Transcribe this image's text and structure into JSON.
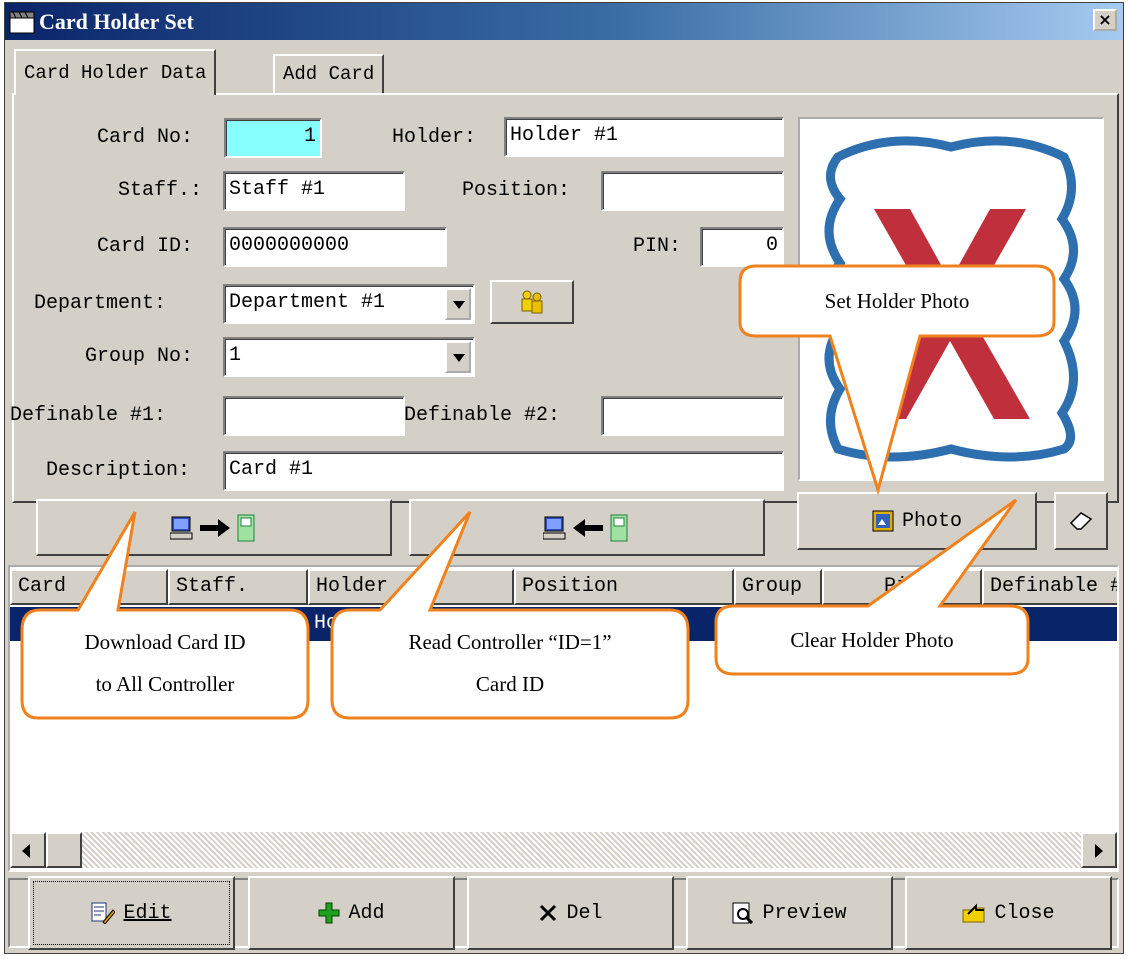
{
  "window": {
    "title": "Card Holder Set",
    "close_glyph": "×"
  },
  "tabs": [
    {
      "label": "Card Holder Data",
      "active": true
    },
    {
      "label": "Add Card",
      "active": false
    }
  ],
  "form": {
    "card_no_label": "Card No:",
    "card_no_value": "1",
    "holder_label": "Holder:",
    "holder_value": "Holder #1",
    "staff_label": "Staff.:",
    "staff_value": "Staff #1",
    "position_label": "Position:",
    "position_value": "",
    "card_id_label": "Card ID:",
    "card_id_value": "0000000000",
    "pin_label": "PIN:",
    "pin_value": "0",
    "department_label": "Department:",
    "department_value": "Department #1",
    "group_label": "Group No:",
    "group_value": "1",
    "def1_label": "Definable #1:",
    "def1_value": "",
    "def2_label": "Definable #2:",
    "def2_value": "",
    "description_label": "Description:",
    "description_value": "Card #1"
  },
  "buttons": {
    "photo_label": "Photo"
  },
  "grid": {
    "columns": [
      "Card",
      "Staff.",
      "Holder",
      "",
      "Position",
      "Group",
      "Pin",
      "Definable #"
    ],
    "rows": [
      {
        "holder": "Ho"
      }
    ]
  },
  "toolbar": {
    "edit": "Edit",
    "add": "Add",
    "del": "Del",
    "preview": "Preview",
    "close": "Close"
  },
  "callouts": {
    "download": "Download Card ID\nto All Controller",
    "read": "Read Controller “ID=1”\nCard ID",
    "set_photo": "Set Holder Photo",
    "clear_photo": "Clear Holder Photo"
  },
  "colors": {
    "selection": "#0a246a",
    "card_no_bg": "#88ffff",
    "callout_border": "#f0821e",
    "photo_x": "#c0303c",
    "photo_frame": "#2e6fb0"
  },
  "icons": [
    "department-lookup-icon",
    "download-to-controller-icon",
    "read-from-controller-icon",
    "photo-icon",
    "eraser-icon",
    "edit-icon",
    "add-icon",
    "delete-icon",
    "preview-icon",
    "close-door-icon"
  ]
}
